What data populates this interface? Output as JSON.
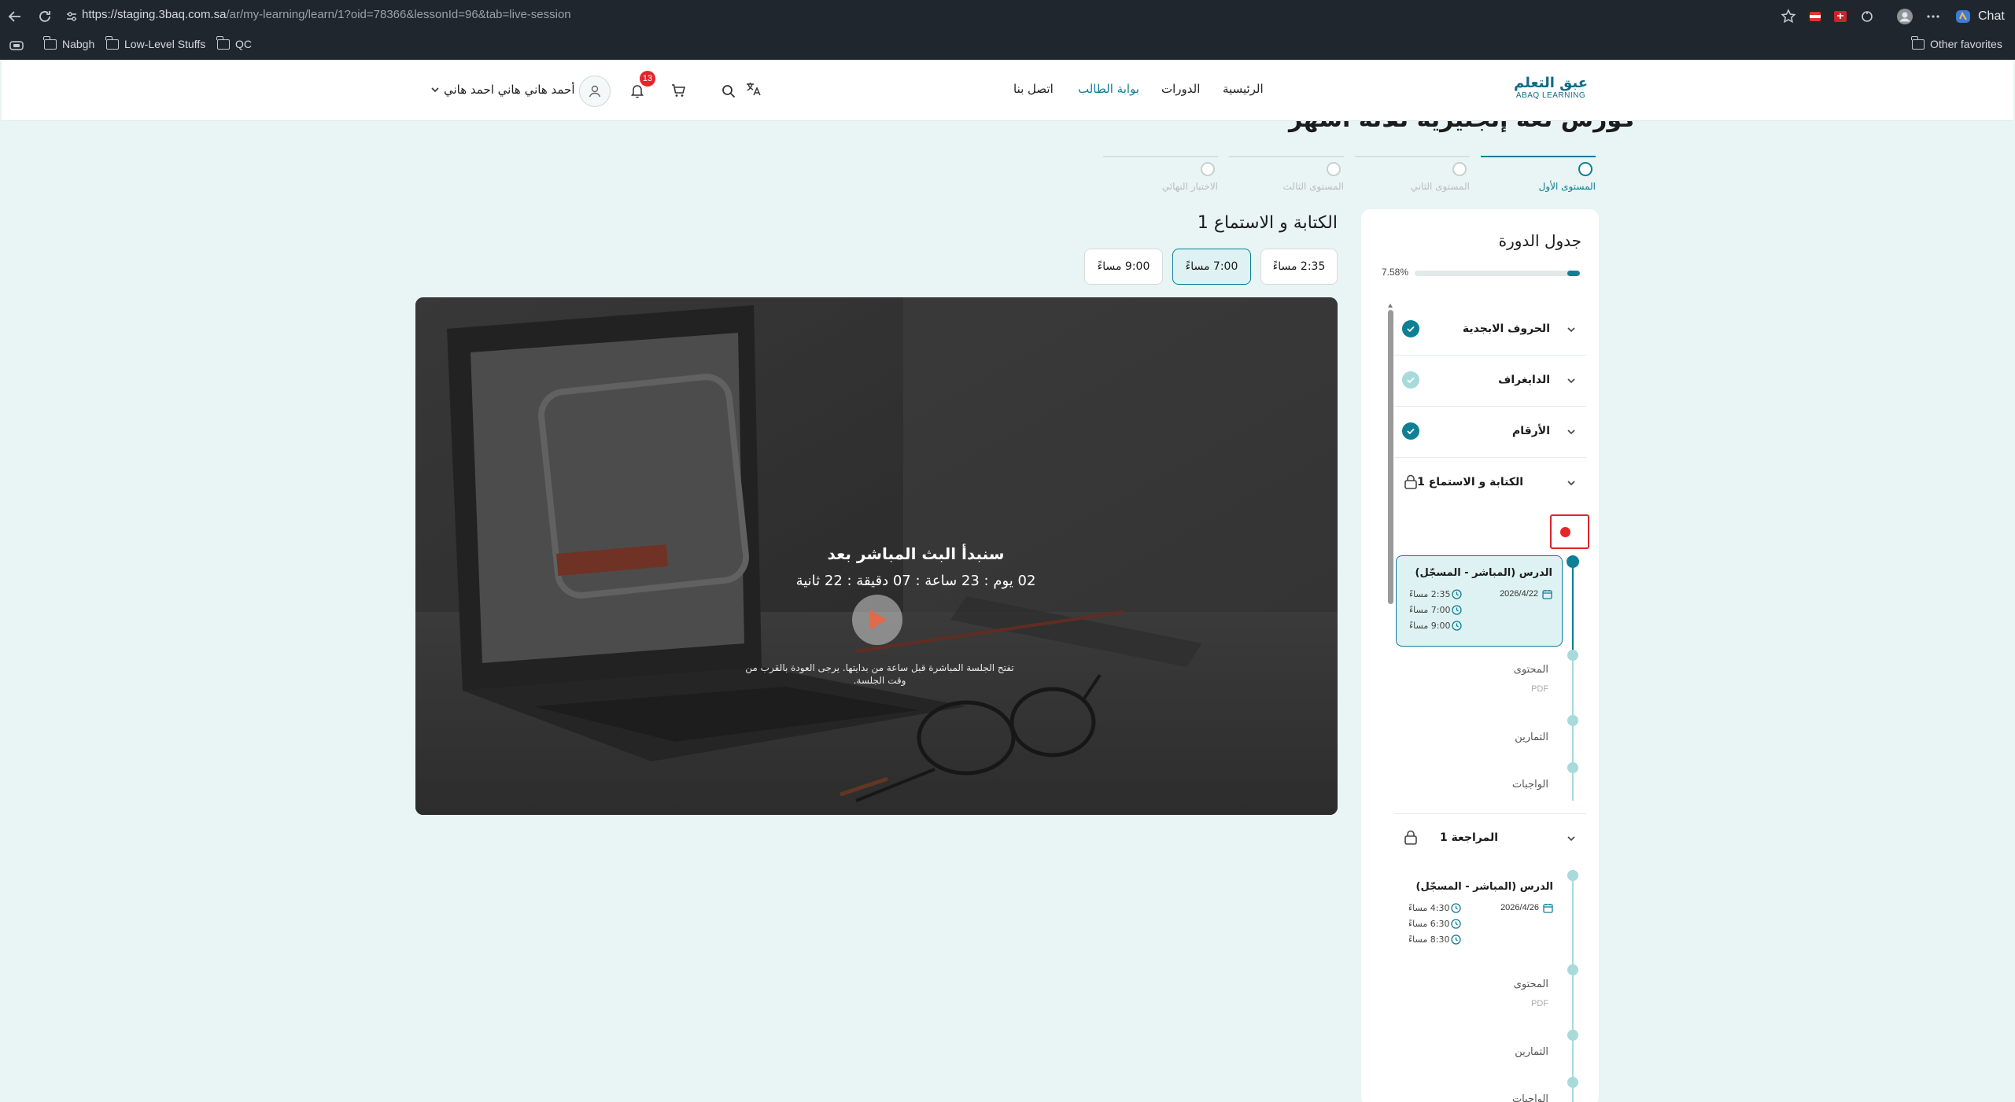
{
  "browser": {
    "url_host": "https://staging.3baq.com.sa",
    "url_path": "/ar/my-learning/learn/1?oid=78366&lessonId=96&tab=live-session",
    "chat_label": "Chat",
    "bookmarks": [
      "Nabgh",
      "Low-Level Stuffs",
      "QC"
    ],
    "other_favorites": "Other favorites"
  },
  "header": {
    "logo_ar": "عبق التعلم",
    "logo_en": "ABAQ LEARNING",
    "nav": [
      "الرئيسية",
      "الدورات",
      "بوابة الطالب",
      "اتصل بنا"
    ],
    "active_nav": "بوابة الطالب",
    "notifications_count": "13",
    "user_name": "أحمد هاني هاني احمد هاني"
  },
  "course": {
    "title": "كورس لغة إنجليزية ثلاثة أشهر",
    "levels": [
      "المستوى الأول",
      "المستوى الثاني",
      "المستوى الثالث",
      "الاختبار النهائي"
    ]
  },
  "lesson": {
    "title": "الكتابة و الاستماع 1",
    "times": [
      "2:35 مساءً",
      "7:00 مساءً",
      "9:00 مساءً"
    ],
    "selected_time": "7:00 مساءً",
    "live_heading": "سنبدأ البث المباشر بعد",
    "countdown": "02 يوم : 23 ساعة : 07 دقيقة : 22 ثانية",
    "note": "تفتح الجلسة المباشرة قبل ساعة من بدايتها. يرجى العودة بالقرب من وقت الجلسة."
  },
  "sidebar": {
    "title": "جدول الدورة",
    "progress_text": "7.58%",
    "progress_value": 7.58,
    "units": [
      {
        "title": "الحروف الابجدية",
        "status": "done"
      },
      {
        "title": "الدايغراف",
        "status": "partial"
      },
      {
        "title": "الأرقام",
        "status": "done"
      },
      {
        "title": "الكتابة و الاستماع 1",
        "status": "locked"
      },
      {
        "title": "المراجعة 1",
        "status": "locked"
      }
    ],
    "lesson1": {
      "title": "الدرس (المباشر - المسجّل)",
      "date": "2026/4/22",
      "times": [
        "2:35 مساءً",
        "7:00 مساءً",
        "9:00 مساءً"
      ],
      "content": "المحتوى",
      "content_type": "PDF",
      "exercises": "التمارين",
      "homework": "الواجبات"
    },
    "lesson2": {
      "title": "الدرس (المباشر - المسجّل)",
      "date": "2026/4/26",
      "times": [
        "4:30 مساءً",
        "6:30 مساءً",
        "8:30 مساءً"
      ],
      "content": "المحتوى",
      "content_type": "PDF",
      "exercises": "التمارين",
      "homework": "الواجبات"
    }
  },
  "colors": {
    "accent": "#0e7f95",
    "light_accent": "#a8dada",
    "alert": "#e5252a",
    "page_bg": "#e9f4f4"
  }
}
